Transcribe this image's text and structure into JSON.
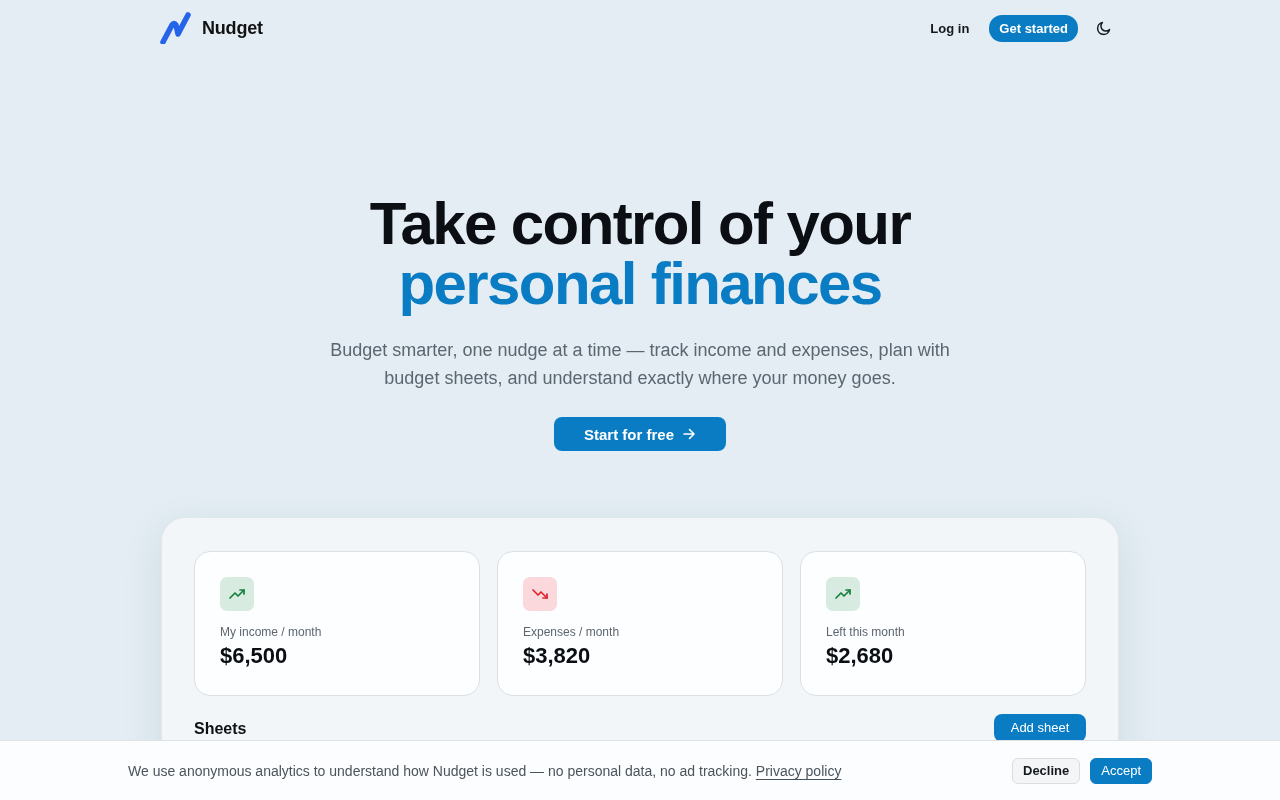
{
  "header": {
    "brand": "Nudget",
    "nav": [
      {
        "label": "Log in",
        "kind": "link"
      },
      {
        "label": "Get started",
        "kind": "primary"
      }
    ]
  },
  "hero": {
    "title_line_1": "Take control of your",
    "title_line_2": "personal finances",
    "subtitle": "Budget smarter, one nudge at a time — track income and expenses, plan with budget sheets, and understand exactly where your money goes.",
    "cta": "Start for free"
  },
  "dashboard": {
    "stats": [
      {
        "label": "My income / month",
        "value": "$6,500",
        "kind": "up"
      },
      {
        "label": "Expenses / month",
        "value": "$3,820",
        "kind": "down"
      },
      {
        "label": "Left this month",
        "value": "$2,680",
        "kind": "up"
      }
    ],
    "sheets": {
      "title": "Sheets",
      "add_button": "Add sheet"
    }
  },
  "cookie_banner": {
    "text": "We use anonymous analytics to understand how Nudget is used — no personal data, no ad tracking.",
    "link": "Privacy policy",
    "buttons": [
      {
        "label": "Decline",
        "kind": "secondary"
      },
      {
        "label": "Accept",
        "kind": "primary"
      }
    ]
  }
}
